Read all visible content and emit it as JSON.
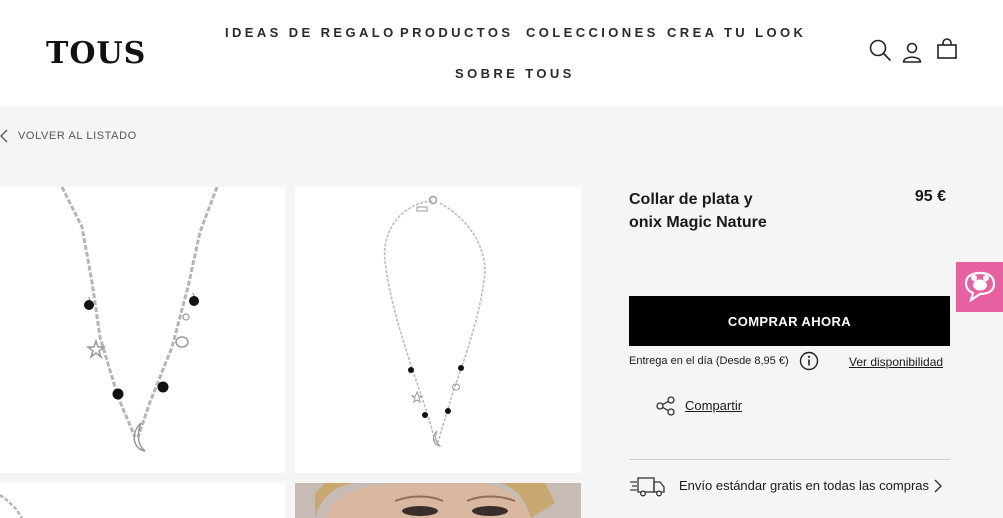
{
  "header": {
    "logo": "TOUS",
    "nav": [
      "IDEAS DE REGALO",
      "PRODUCTOS",
      "COLECCIONES",
      "CREA TU LOOK",
      "SOBRE TOUS"
    ],
    "icons": [
      "search-icon",
      "user-icon",
      "bag-icon"
    ]
  },
  "breadcrumb": {
    "back_label": "VOLVER AL LISTADO"
  },
  "product": {
    "title_line1": "Collar de plata y",
    "title_line2": "onix Magic Nature",
    "price": "95 €",
    "buy_label": "COMPRAR AHORA",
    "delivery_text": "Entrega en el día (Desde 8,95 €)",
    "availability_label": "Ver disponibilidad",
    "share_label": "Compartir",
    "shipping_text": "Envío estándar gratis en todas las compras"
  },
  "colors": {
    "buy_button": "#000000",
    "chat_widget": "#e7609f",
    "page_bg": "#f5f5f5"
  }
}
